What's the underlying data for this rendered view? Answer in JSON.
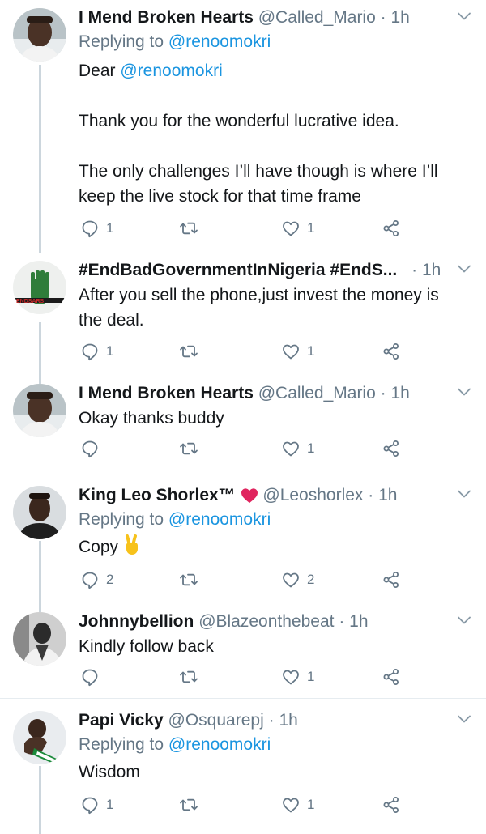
{
  "tweets": [
    {
      "name": "I Mend Broken Hearts",
      "handle": "@Called_Mario",
      "dot": "·",
      "time": "1h",
      "replying_label": "Replying to",
      "replying_to": "@renoomokri",
      "body_lead": "Dear",
      "body_mention": "@renoomokri",
      "body_p2": "Thank you for the wonderful lucrative idea.",
      "body_p3": "The only challenges I’ll have though is where I’ll keep the live stock for that time frame",
      "reply_count": "1",
      "like_count": "1"
    },
    {
      "name": "#EndBadGovernmentInNigeria #EndS...",
      "dot": "·",
      "time": "1h",
      "avatar_text": "ENDSARS",
      "body": "After you sell the phone,just invest the money is the deal.",
      "reply_count": "1",
      "like_count": "1"
    },
    {
      "name": "I Mend Broken Hearts",
      "handle": "@Called_Mario",
      "dot": "·",
      "time": "1h",
      "body": "Okay thanks buddy",
      "like_count": "1"
    },
    {
      "name": "King Leo Shorlex™",
      "handle": "@Leoshorlex",
      "dot": "·",
      "time": "1h",
      "replying_label": "Replying to",
      "replying_to": "@renoomokri",
      "body": "Copy",
      "reply_count": "2",
      "like_count": "2"
    },
    {
      "name": "Johnnybellion",
      "handle": "@Blazeonthebeat",
      "dot": "·",
      "time": "1h",
      "body": "Kindly follow back",
      "like_count": "1"
    },
    {
      "name": "Papi Vicky",
      "handle": "@Osquarepj",
      "dot": "·",
      "time": "1h",
      "replying_label": "Replying to",
      "replying_to": "@renoomokri",
      "body": "Wisdom",
      "reply_count": "1",
      "like_count": "1"
    }
  ],
  "colors": {
    "accent": "#1b95e0",
    "muted": "#657786",
    "line": "#ccd6dd",
    "separator": "#e6ecf0"
  },
  "icons": [
    "reply-icon",
    "retweet-icon",
    "like-icon",
    "share-icon",
    "chevron-down-icon",
    "heart-emoji-icon",
    "victory-hand-emoji-icon"
  ]
}
